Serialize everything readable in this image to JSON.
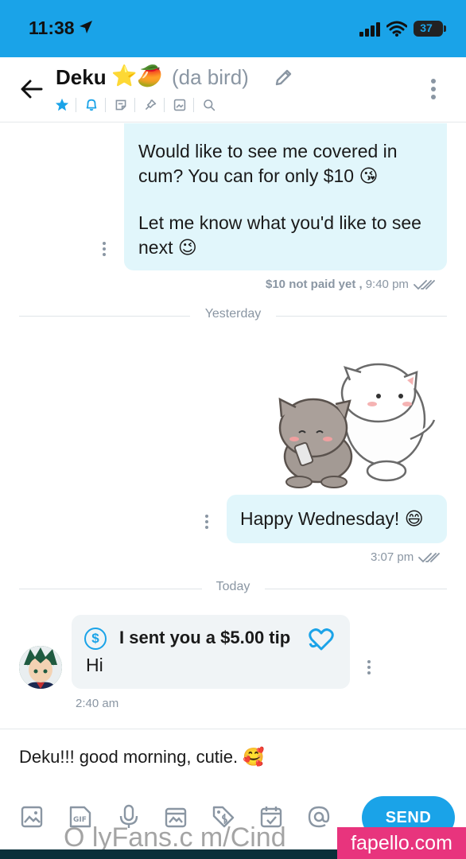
{
  "status_bar": {
    "time": "11:38",
    "battery": "37"
  },
  "header": {
    "contact_name": "Deku",
    "contact_emoji": "⭐🥭",
    "contact_nickname": "(da bird)",
    "icons": [
      "star-icon",
      "bell-icon",
      "note-icon",
      "pin-icon",
      "media-icon",
      "search-icon"
    ]
  },
  "messages": [
    {
      "line1": "Would like to see me covered in",
      "line2": "cum? You can for only $10 😘",
      "line3": "Let me know what you'd like to see",
      "line4": "next 😉",
      "status_bold": "$10 not paid yet ,",
      "time": "9:40 pm"
    },
    {
      "text": "Happy Wednesday! 😄",
      "time": "3:07 pm"
    }
  ],
  "dividers": {
    "yesterday": "Yesterday",
    "today": "Today"
  },
  "tip_message": {
    "icon_symbol": "$",
    "title": "I sent you a $5.00 tip",
    "text": "Hi",
    "time": "2:40 am"
  },
  "composer": {
    "text": "Deku!!! good morning, cutie. 🥰",
    "gif_label": "GIF",
    "send_label": "SEND"
  },
  "watermark": "O lyFans.c m/Cind",
  "fapello": "fapello.com",
  "colors": {
    "accent": "#1aa3e8",
    "bubble_out": "#e1f6fb",
    "bubble_in": "#f0f4f6",
    "muted": "#8a96a3"
  }
}
